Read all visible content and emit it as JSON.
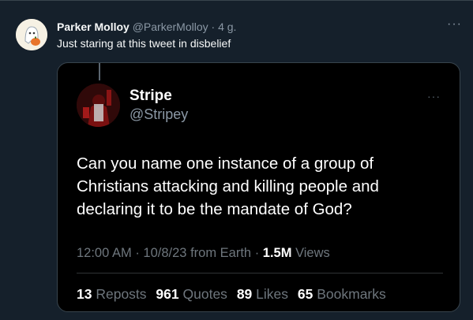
{
  "outer": {
    "name": "Parker Molloy",
    "handle": "@ParkerMolloy",
    "separator": "·",
    "time": "4 g.",
    "text": "Just staring at this tweet in disbelief",
    "more": "···"
  },
  "quoted": {
    "name": "Stripe",
    "handle": "@Stripey",
    "more": "···",
    "body": "Can you name one instance of a group of Christians attacking and killing people and declaring it to be the mandate of God?",
    "time": "12:00 AM",
    "date": "10/8/23",
    "source": "from Earth",
    "views_count": "1.5M",
    "views_label": "Views",
    "dot": "·",
    "stats": {
      "reposts_count": "13",
      "reposts_label": "Reposts",
      "quotes_count": "961",
      "quotes_label": "Quotes",
      "likes_count": "89",
      "likes_label": "Likes",
      "bookmarks_count": "65",
      "bookmarks_label": "Bookmarks"
    }
  },
  "colors": {
    "background": "#15202b",
    "card_background": "#000000",
    "muted_text": "#8b98a5",
    "border": "#38444d"
  }
}
